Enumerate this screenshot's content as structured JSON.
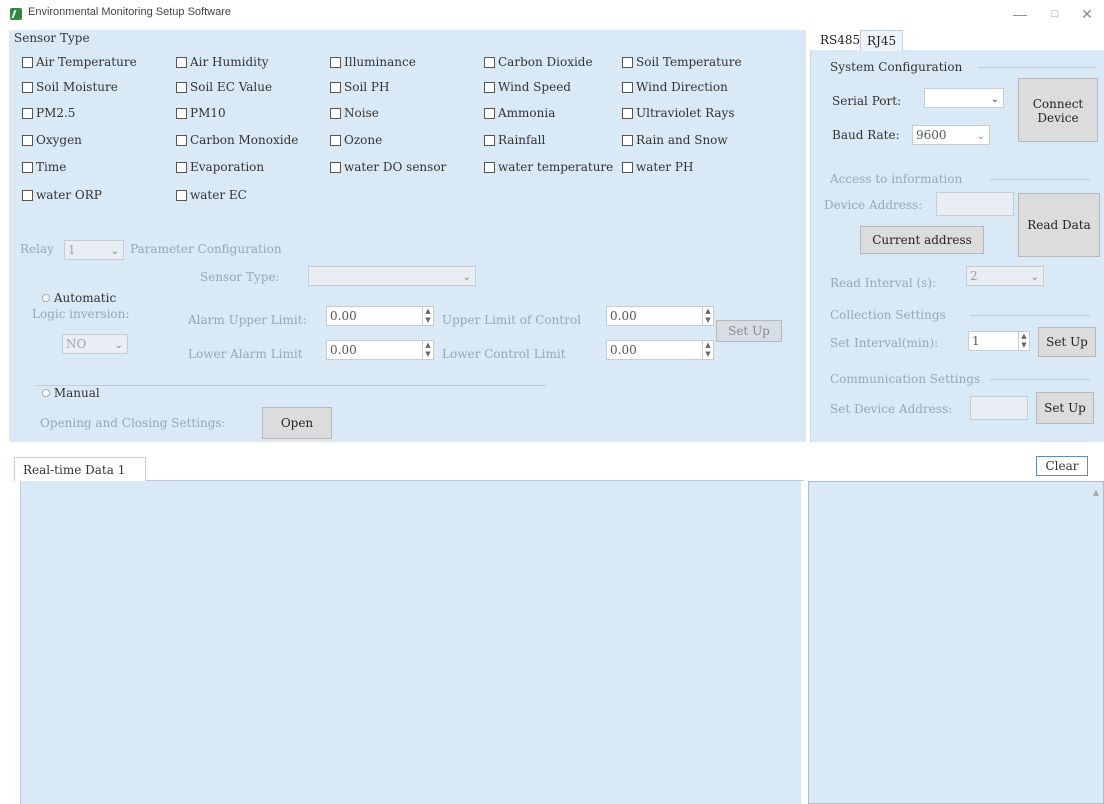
{
  "window": {
    "title": "Environmental Monitoring Setup Software",
    "minimize": "—",
    "maximize": "□",
    "close": "✕"
  },
  "sensor_type": {
    "title": "Sensor Type",
    "items": [
      "Air Temperature",
      "Air Humidity",
      "Illuminance",
      "Carbon Dioxide",
      "Soil Temperature",
      "Soil Moisture",
      "Soil EC Value",
      "Soil PH",
      "Wind Speed",
      "Wind Direction",
      "PM2.5",
      "PM10",
      "Noise",
      "Ammonia",
      "Ultraviolet Rays",
      "Oxygen",
      "Carbon Monoxide",
      "Ozone",
      "Rainfall",
      "Rain and Snow",
      "Time",
      "Evaporation",
      "water DO sensor",
      "water temperature",
      "water PH",
      "water ORP",
      "water EC"
    ]
  },
  "relay": {
    "label": "Relay",
    "value": "1",
    "param_config": "Parameter Configuration",
    "sensor_type_label": "Sensor Type:",
    "sensor_type_value": "",
    "automatic": "Automatic",
    "logic_inversion": "Logic inversion:",
    "logic_value": "NO",
    "alarm_upper_label": "Alarm Upper Limit:",
    "alarm_upper_value": "0.00",
    "upper_control_label": "Upper Limit of Control",
    "upper_control_value": "0.00",
    "lower_alarm_label": "Lower Alarm Limit",
    "lower_alarm_value": "0.00",
    "lower_control_label": "Lower Control Limit",
    "lower_control_value": "0.00",
    "set_up": "Set Up",
    "manual": "Manual",
    "open_close_label": "Opening and Closing Settings:",
    "open_button": "Open"
  },
  "right": {
    "tabs": [
      "RS485",
      "RJ45"
    ],
    "system_config": "System Configuration",
    "serial_port_label": "Serial Port:",
    "serial_port_value": "",
    "baud_rate_label": "Baud Rate:",
    "baud_rate_value": "9600",
    "connect_button_line1": "Connect",
    "connect_button_line2": "Device",
    "access_info": "Access to information",
    "device_address_label": "Device Address:",
    "device_address_value": "",
    "current_address_button": "Current address",
    "read_data_button": "Read Data",
    "read_interval_label": "Read Interval (s):",
    "read_interval_value": "2",
    "collection_settings": "Collection Settings",
    "set_interval_label": "Set Interval(min):",
    "set_interval_value": "1",
    "collection_set_up": "Set Up",
    "comm_settings": "Communication Settings",
    "set_device_address_label": "Set Device Address:",
    "set_device_address_value": "",
    "comm_set_up": "Set Up"
  },
  "data": {
    "tab": "Real-time Data 1",
    "clear_button": "Clear"
  }
}
